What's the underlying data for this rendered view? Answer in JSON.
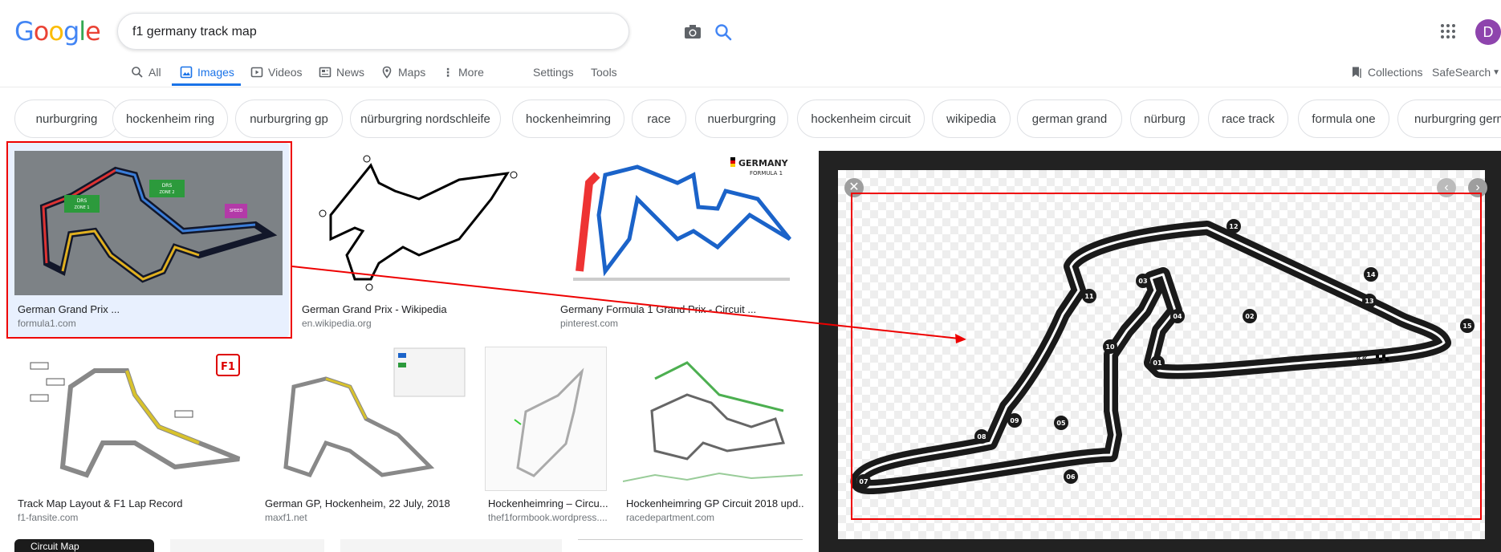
{
  "logo": [
    "G",
    "o",
    "o",
    "g",
    "l",
    "e"
  ],
  "search": {
    "query": "f1 germany track map"
  },
  "tabs": [
    {
      "label": "All"
    },
    {
      "label": "Images"
    },
    {
      "label": "Videos"
    },
    {
      "label": "News"
    },
    {
      "label": "Maps"
    },
    {
      "label": "More"
    }
  ],
  "tools": {
    "settings": "Settings",
    "tools": "Tools",
    "collections": "Collections",
    "safesearch": "SafeSearch"
  },
  "avatar_letter": "D",
  "chips": [
    "nurburgring",
    "hockenheim ring",
    "nurburgring gp",
    "nürburgring nordschleife",
    "hockenheimring",
    "race",
    "nuerburgring",
    "hockenheim circuit",
    "wikipedia",
    "german grand",
    "nürburg",
    "race track",
    "formula one",
    "nurburgring germ"
  ],
  "results_row1": [
    {
      "title": "German Grand Prix ...",
      "source": "formula1.com"
    },
    {
      "title": "German Grand Prix - Wikipedia",
      "source": "en.wikipedia.org"
    },
    {
      "title": "Germany Formula 1 Grand Prix - Circuit ...",
      "source": "pinterest.com"
    }
  ],
  "results_row2": [
    {
      "title": "Track Map Layout & F1 Lap Record",
      "source": "f1-fansite.com"
    },
    {
      "title": "German GP, Hockenheim, 22 July, 2018",
      "source": "maxf1.net"
    },
    {
      "title": "Hockenheimring – Circu...",
      "source": "thef1formbook.wordpress...."
    },
    {
      "title": "Hockenheimring GP Circuit 2018 upd...",
      "source": "racedepartment.com"
    }
  ],
  "thumb_text": {
    "germany": "GERMANY",
    "formula1": "FORMULA 1",
    "drs1": "DRS DETECTION ZONE 1",
    "drs2": "DRS DETECTION ZONE 2",
    "speedtrap": "SPEED TRAP",
    "f1": "F1",
    "circuit_map": "Circuit Map"
  },
  "corner_labels": [
    "01",
    "02",
    "03",
    "04",
    "05",
    "06",
    "07",
    "08",
    "09",
    "10",
    "11",
    "12",
    "13",
    "14",
    "15"
  ],
  "colors": {
    "accent": "#1a73e8",
    "annotation": "#e00000",
    "avatar": "#8e44ad"
  }
}
